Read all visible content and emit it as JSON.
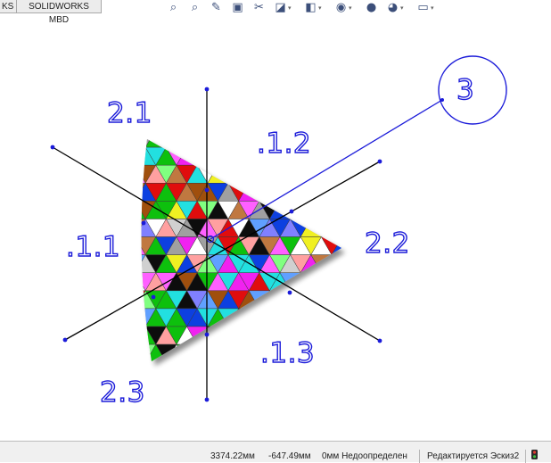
{
  "tabs": [
    {
      "label": "KS"
    },
    {
      "label": "SOLIDWORKS MBD"
    }
  ],
  "toolbar": {
    "icons": [
      {
        "name": "zoom-to-fit-icon",
        "glyph": "⌕",
        "dropdown": false
      },
      {
        "name": "zoom-area-icon",
        "glyph": "⌕",
        "dropdown": false
      },
      {
        "name": "previous-view-icon",
        "glyph": "✎",
        "dropdown": false
      },
      {
        "name": "section-view-icon",
        "glyph": "▣",
        "dropdown": false
      },
      {
        "name": "dynamic-annotation-icon",
        "glyph": "✂",
        "dropdown": false
      },
      {
        "name": "view-orientation-icon",
        "glyph": "◪",
        "dropdown": true
      },
      {
        "name": "display-style-icon",
        "glyph": "◧",
        "dropdown": true
      },
      {
        "name": "hide-show-items-icon",
        "glyph": "◉",
        "dropdown": true
      },
      {
        "name": "edit-appearance-icon",
        "glyph": "●",
        "dropdown": false
      },
      {
        "name": "apply-scene-icon",
        "glyph": "◕",
        "dropdown": true
      },
      {
        "name": "view-settings-icon",
        "glyph": "▭",
        "dropdown": true
      }
    ]
  },
  "annotations": {
    "label_2_1": "2.1",
    "label_1_2": ".1.2",
    "label_1_1": ".1.1",
    "label_2_2": "2.2",
    "label_1_3": ".1.3",
    "label_2_3": "2.3",
    "balloon": "3"
  },
  "colors": {
    "dimension": "#1b1bd9",
    "axis": "#000000",
    "balloon_leader": "#1b1bd9"
  },
  "statusbar": {
    "x_coord": "3374.22мм",
    "y_coord": "-647.49мм",
    "z_and_state": "0мм Недоопределен",
    "mode": "Редактируется Эскиз2"
  }
}
